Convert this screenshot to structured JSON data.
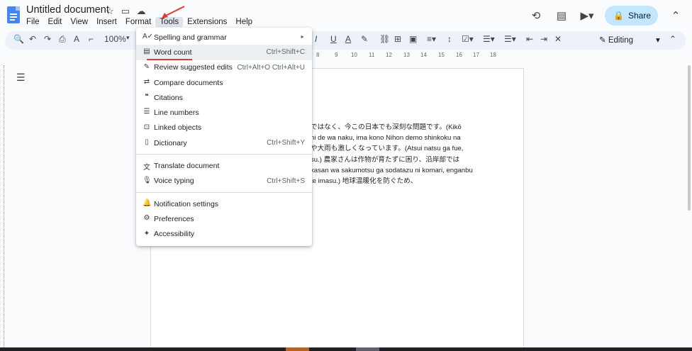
{
  "app": {
    "doc_title": "Untitled document",
    "menus": [
      "File",
      "Edit",
      "View",
      "Insert",
      "Format",
      "Tools",
      "Extensions",
      "Help"
    ],
    "active_menu": "Tools",
    "share_label": "Share",
    "editing_label": "Editing",
    "zoom": "100%"
  },
  "tools_menu": {
    "items": [
      {
        "label": "Spelling and grammar",
        "shortcut": "",
        "icon": "spellcheck-icon",
        "submenu": true
      },
      {
        "label": "Word count",
        "shortcut": "Ctrl+Shift+C",
        "icon": "word-count-icon"
      },
      {
        "label": "Review suggested edits",
        "shortcut": "Ctrl+Alt+O Ctrl+Alt+U",
        "icon": "review-edits-icon"
      },
      {
        "label": "Compare documents",
        "shortcut": "",
        "icon": "compare-icon"
      },
      {
        "label": "Citations",
        "shortcut": "",
        "icon": "quote-icon"
      },
      {
        "label": "Line numbers",
        "shortcut": "",
        "icon": "line-numbers-icon"
      },
      {
        "label": "Linked objects",
        "shortcut": "",
        "icon": "linked-objects-icon"
      },
      {
        "label": "Dictionary",
        "shortcut": "Ctrl+Shift+Y",
        "icon": "dictionary-icon"
      },
      {
        "label": "Translate document",
        "shortcut": "",
        "icon": "translate-icon"
      },
      {
        "label": "Voice typing",
        "shortcut": "Ctrl+Shift+S",
        "icon": "microphone-icon"
      },
      {
        "label": "Notification settings",
        "shortcut": "",
        "icon": "bell-icon"
      },
      {
        "label": "Preferences",
        "shortcut": "",
        "icon": "preferences-icon"
      },
      {
        "label": "Accessibility",
        "shortcut": "",
        "icon": "accessibility-icon"
      }
    ]
  },
  "document": {
    "lines": [
      "ではなく、今この日本でも深刻な問題です。(Kikō",
      "hi de wa naku, ima kono Nihon demo shinkoku na",
      "や大雨も激しくなっています。(Atsui natsu ga fue,",
      "su.) 農家さんは作物が育たずに困り、沿岸部では",
      "kasan wa sakumotsu ga sodatazu ni komari, enganbu",
      "te imasu.) 地球温暖化を防ぐため、"
    ]
  },
  "ruler": {
    "ticks": [
      "8",
      "9",
      "10",
      "11",
      "12",
      "13",
      "14",
      "15",
      "16",
      "17",
      "18"
    ]
  }
}
